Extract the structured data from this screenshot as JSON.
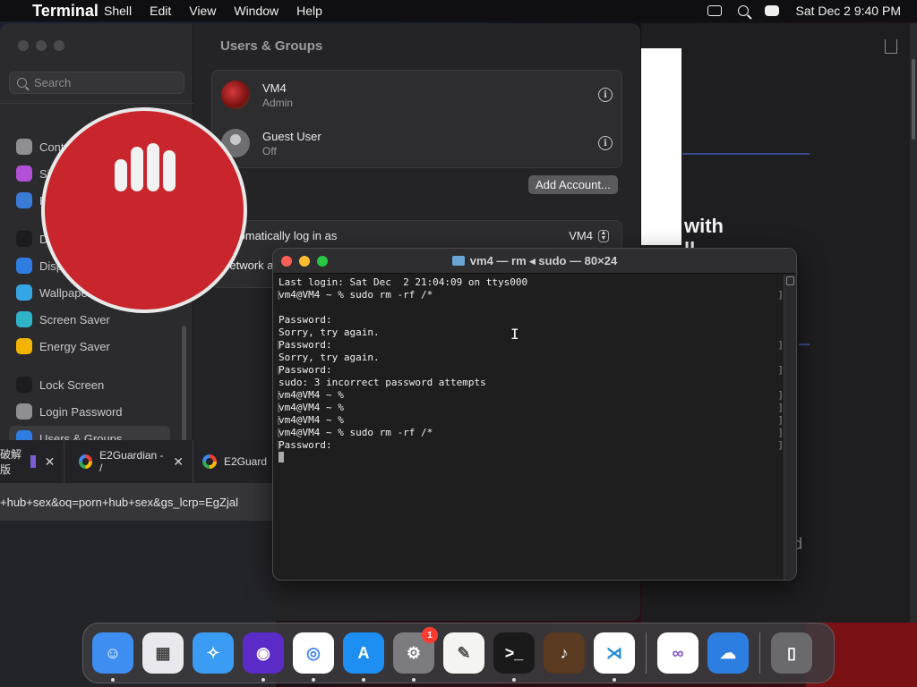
{
  "menubar": {
    "app_name": "Terminal",
    "items": [
      "Shell",
      "Edit",
      "View",
      "Window",
      "Help"
    ],
    "clock": "Sat Dec 2  9:40 PM"
  },
  "settings": {
    "search_placeholder": "Search",
    "sidebar": [
      {
        "label": "Control Center",
        "color": "#8e8e93"
      },
      {
        "label": "Siri & Spotlight",
        "color": "#b14fd6"
      },
      {
        "label": "Privacy & Security",
        "color": "#3a7bd5"
      },
      {
        "label": "Desktop & Dock",
        "color": "#1c1c1e"
      },
      {
        "label": "Displays",
        "color": "#2f7de1"
      },
      {
        "label": "Wallpaper",
        "color": "#36a5e6"
      },
      {
        "label": "Screen Saver",
        "color": "#2fb3c9"
      },
      {
        "label": "Energy Saver",
        "color": "#f2b400"
      },
      {
        "label": "Lock Screen",
        "color": "#1c1c1e"
      },
      {
        "label": "Login Password",
        "color": "#8e8e93"
      },
      {
        "label": "Users & Groups",
        "color": "#2f7de1"
      }
    ],
    "title": "Users & Groups",
    "users": [
      {
        "name": "VM4",
        "role": "Admin"
      },
      {
        "name": "Guest User",
        "role": "Off"
      }
    ],
    "add_account_label": "Add Account...",
    "auto_login_label": "Automatically log in as",
    "auto_login_value": "VM4",
    "network_label": "Network a"
  },
  "browser": {
    "tab1_label": "破解版",
    "tab2_label": "E2Guardian - /",
    "tab3_label": "E2Guard",
    "url": "+hub+sex&oq=porn+hub+sex&gs_lcrp=EgZjal"
  },
  "background_window": {
    "heading_fragment": "with",
    "heading_fragment2": "ll",
    "stray": "d"
  },
  "terminal": {
    "title": "vm4 — rm ◂ sudo — 80×24",
    "lines": [
      "Last login: Sat Dec  2 21:04:09 on ttys000",
      "vm4@VM4 ~ % sudo rm -rf /*",
      "",
      "Password:",
      "Sorry, try again.",
      "Password:",
      "Sorry, try again.",
      "Password:",
      "sudo: 3 incorrect password attempts",
      "vm4@VM4 ~ %",
      "vm4@VM4 ~ %",
      "vm4@VM4 ~ %",
      "vm4@VM4 ~ % sudo rm -rf /*",
      "Password:"
    ]
  },
  "dock": {
    "apps": [
      {
        "name": "finder-icon",
        "bg": "#3d8ef0",
        "running": true
      },
      {
        "name": "launchpad-icon",
        "bg": "#e8e8ee",
        "running": false
      },
      {
        "name": "safari-icon",
        "bg": "#3a9cf2",
        "running": false
      },
      {
        "name": "firefox-icon",
        "bg": "#5b2bc7",
        "running": true
      },
      {
        "name": "chrome-icon",
        "bg": "#ffffff",
        "running": true
      },
      {
        "name": "app-store-icon",
        "bg": "#1d8ff2",
        "running": true
      },
      {
        "name": "system-settings-icon",
        "bg": "#7b7b80",
        "running": true,
        "badge": "1"
      },
      {
        "name": "textedit-icon",
        "bg": "#f4f4f0",
        "running": false
      },
      {
        "name": "terminal-icon",
        "bg": "#1a1a1a",
        "running": true
      },
      {
        "name": "garageband-icon",
        "bg": "#5a3a20",
        "running": false
      },
      {
        "name": "vscode-icon",
        "bg": "#ffffff",
        "running": true
      },
      {
        "name": "visual-studio-icon",
        "bg": "#ffffff",
        "running": false
      },
      {
        "name": "weather-icon",
        "bg": "#2c7fe0",
        "running": false
      },
      {
        "name": "trash-icon",
        "bg": "#6a6a6e",
        "running": false
      }
    ]
  }
}
